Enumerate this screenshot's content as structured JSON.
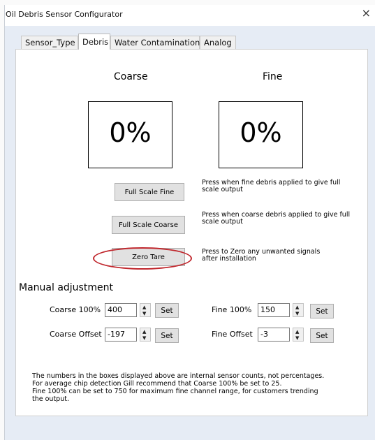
{
  "window": {
    "title": "Oil Debris Sensor Configurator",
    "close_glyph": "×"
  },
  "tabs": [
    {
      "label": "Sensor_Type",
      "active": false
    },
    {
      "label": "Debris",
      "active": true
    },
    {
      "label": "Water Contamination",
      "active": false
    },
    {
      "label": "Analog",
      "active": false
    }
  ],
  "coarse": {
    "heading": "Coarse",
    "value": "0%"
  },
  "fine": {
    "heading": "Fine",
    "value": "0%"
  },
  "actions": [
    {
      "label": "Full Scale Fine",
      "hint_line1": "Press when fine debris applied to give full",
      "hint_line2": "scale output"
    },
    {
      "label": "Full Scale Coarse",
      "hint_line1": "Press when coarse debris applied to give full",
      "hint_line2": "scale output"
    },
    {
      "label": "Zero Tare",
      "hint_line1": "Press to Zero any unwanted signals",
      "hint_line2": "after installation"
    }
  ],
  "manual": {
    "heading": "Manual adjustment",
    "coarse_100": {
      "label": "Coarse 100%",
      "value": "400",
      "set_label": "Set"
    },
    "fine_100": {
      "label": "Fine 100%",
      "value": "150",
      "set_label": "Set"
    },
    "coarse_offset": {
      "label": "Coarse Offset",
      "value": "-197",
      "set_label": "Set"
    },
    "fine_offset": {
      "label": "Fine Offset",
      "value": "-3",
      "set_label": "Set"
    }
  },
  "note": {
    "line1": "The numbers in the boxes displayed above are internal sensor counts, not percentages.",
    "line2": "For average chip detection Gill recommend that Coarse 100% be set to 25.",
    "line3": "Fine 100% can be set to 750 for maximum fine channel range, for customers trending",
    "line4": "the output."
  },
  "colors": {
    "highlight_oval": "#c0272d",
    "client_bg": "#e6ecf5"
  },
  "icons": {
    "close": "close-icon",
    "spin_up": "▲",
    "spin_down": "▼"
  }
}
